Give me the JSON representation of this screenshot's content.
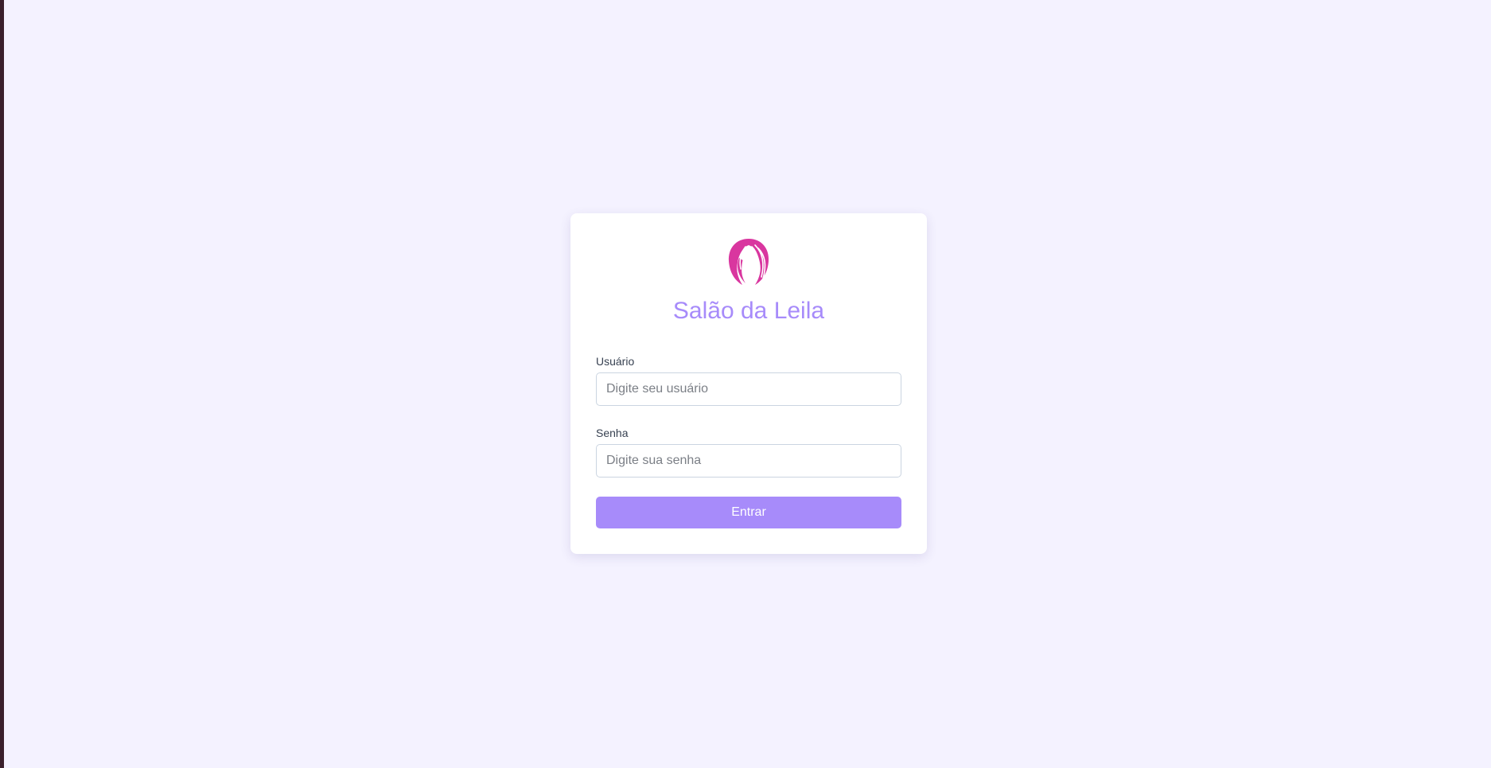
{
  "app": {
    "title": "Salão da Leila",
    "logo_icon": "hair-woman-logo-icon"
  },
  "form": {
    "username_label": "Usuário",
    "username_placeholder": "Digite seu usuário",
    "username_value": "",
    "password_label": "Senha",
    "password_placeholder": "Digite sua senha",
    "password_value": "",
    "submit_label": "Entrar"
  },
  "colors": {
    "background": "#f4f2ff",
    "card": "#ffffff",
    "accent": "#a78bfa",
    "logo": "#d9369f"
  }
}
